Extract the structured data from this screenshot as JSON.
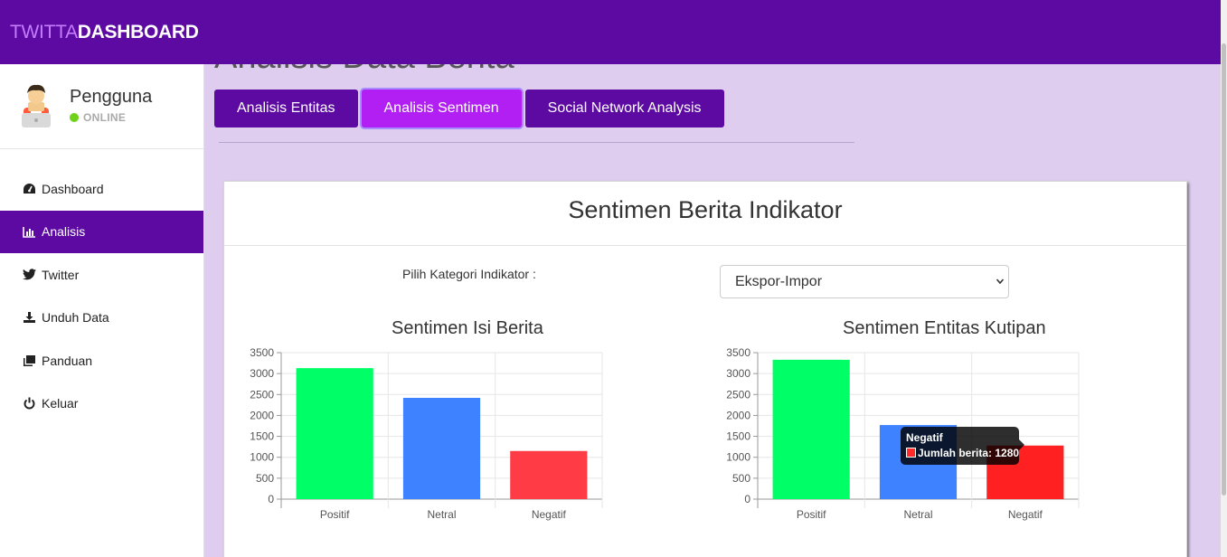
{
  "brand": {
    "part1": "TWITTA",
    "part2": "DASHBOARD"
  },
  "user": {
    "name": "Pengguna",
    "status": "ONLINE"
  },
  "sidebar": {
    "items": [
      {
        "label": "Dashboard",
        "icon": "dashboard-icon",
        "active": false
      },
      {
        "label": "Analisis",
        "icon": "bar-chart-icon",
        "active": true
      },
      {
        "label": "Twitter",
        "icon": "twitter-icon",
        "active": false
      },
      {
        "label": "Unduh Data",
        "icon": "download-icon",
        "active": false
      },
      {
        "label": "Panduan",
        "icon": "copy-icon",
        "active": false
      },
      {
        "label": "Keluar",
        "icon": "power-icon",
        "active": false
      }
    ]
  },
  "page": {
    "heading": "Analisis Data Berita"
  },
  "tabs": [
    {
      "label": "Analisis Entitas",
      "active": false
    },
    {
      "label": "Analisis Sentimen",
      "active": true
    },
    {
      "label": "Social Network Analysis",
      "active": false
    }
  ],
  "card": {
    "title": "Sentimen Berita Indikator",
    "select_label": "Pilih Kategori Indikator :",
    "select_value": "Ekspor-Impor"
  },
  "colors": {
    "positif": "#00ff66",
    "netral": "#3f82ff",
    "negatif_left": "#ff3b46",
    "negatif_right": "#ff2121",
    "brand": "#5c0aa1"
  },
  "tooltip": {
    "title": "Negatif",
    "label": "Jumlah berita:",
    "value": "1280"
  },
  "chart_data": [
    {
      "type": "bar",
      "title": "Sentimen Isi Berita",
      "categories": [
        "Positif",
        "Netral",
        "Negatif"
      ],
      "values": [
        3130,
        2420,
        1150
      ],
      "colors": [
        "#00ff66",
        "#3f82ff",
        "#ff3b46"
      ],
      "yticks": [
        "3500",
        "3000",
        "2500",
        "2000",
        "1500",
        "1000",
        "500",
        "0"
      ],
      "ylim": [
        0,
        3500
      ],
      "grid": true
    },
    {
      "type": "bar",
      "title": "Sentimen Entitas Kutipan",
      "categories": [
        "Positif",
        "Netral",
        "Negatif"
      ],
      "values": [
        3330,
        1770,
        1280
      ],
      "colors": [
        "#00ff66",
        "#3f82ff",
        "#ff2121"
      ],
      "yticks": [
        "3500",
        "3000",
        "2500",
        "2000",
        "1500",
        "1000",
        "500",
        "0"
      ],
      "ylim": [
        0,
        3500
      ],
      "grid": true
    }
  ]
}
